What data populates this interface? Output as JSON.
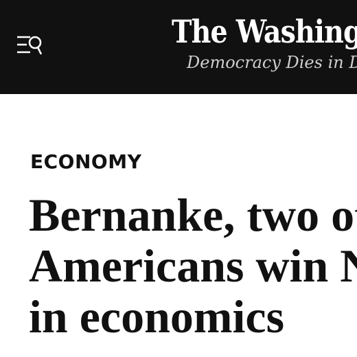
{
  "masthead": {
    "logo_text": "The Washington Post",
    "tagline": "Democracy Dies in Darkness",
    "background_color": "#111111",
    "menu_icon": "menu-search-icon"
  },
  "article": {
    "section": "ECONOMY",
    "headline_lines": [
      "Bernanke, two other",
      "Americans win Nobel",
      "in economics"
    ]
  }
}
